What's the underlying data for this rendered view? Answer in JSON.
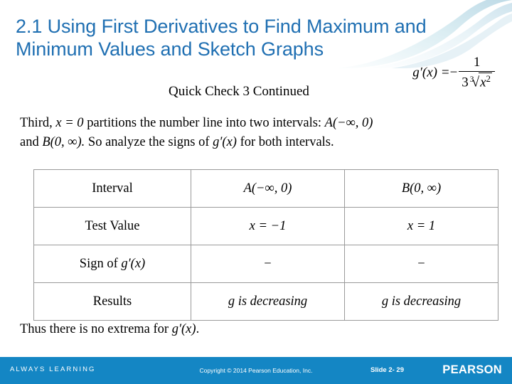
{
  "slide": {
    "title": "2.1 Using First Derivatives to Find Maximum and Minimum Values and Sketch Graphs",
    "subtitle": "Quick Check 3 Continued",
    "title_color": "#1F6FB2",
    "accent_color": "#1486C4"
  },
  "top_formula": {
    "lhs": "g′(x) =",
    "sign": "−",
    "numerator": "1",
    "denominator_coefficient": "3",
    "denominator_root_index": "3",
    "denominator_radicand": "x",
    "denominator_radicand_exponent": "2"
  },
  "body": {
    "line1_a": "Third,",
    "line1_eq": "x = 0",
    "line1_b": "partitions the number line into two intervals:",
    "line1_interval_a": "A(−∞, 0)",
    "line2_a": "and",
    "line2_interval_b": "B(0, ∞).",
    "line2_b": "So analyze the signs of",
    "line2_expr": "g′(x)",
    "line2_c": "for both intervals."
  },
  "table": {
    "rows": [
      {
        "label": "Interval",
        "label_extra": "",
        "col_a": "A(−∞, 0)",
        "col_b": "B(0, ∞)"
      },
      {
        "label": "Test Value",
        "label_extra": "",
        "col_a": "x = −1",
        "col_b": "x = 1"
      },
      {
        "label": "Sign of",
        "label_extra": "g′(x)",
        "col_a": "−",
        "col_b": "−"
      },
      {
        "label": "Results",
        "label_extra": "",
        "col_a": "g is decreasing",
        "col_b": "g is decreasing"
      }
    ]
  },
  "closing": {
    "text_a": "Thus there is no extrema for",
    "expr": "g′(x)",
    "text_b": "."
  },
  "footer": {
    "always_learning": "ALWAYS LEARNING",
    "copyright": "Copyright © 2014 Pearson Education, Inc.",
    "slide_number": "Slide 2- 29",
    "brand": "PEARSON"
  }
}
